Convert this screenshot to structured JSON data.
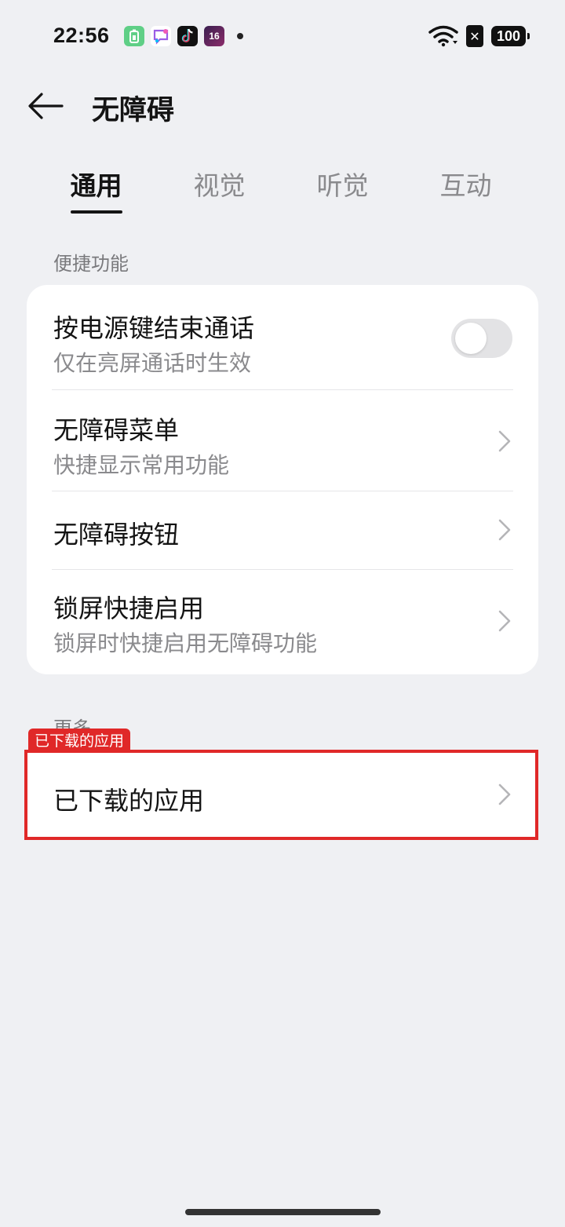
{
  "status_bar": {
    "time": "22:56",
    "battery_level": "100",
    "sim_icon_glyph": "✕",
    "notification_icons": [
      "battery-app-icon",
      "chat-app-icon",
      "tiktok-icon",
      "sixteen-app-icon"
    ],
    "sixteen_label": "16"
  },
  "header": {
    "title": "无障碍"
  },
  "tabs": [
    {
      "label": "通用",
      "active": true
    },
    {
      "label": "视觉",
      "active": false
    },
    {
      "label": "听觉",
      "active": false
    },
    {
      "label": "互动",
      "active": false
    }
  ],
  "sections": {
    "shortcut": {
      "header": "便捷功能",
      "items": [
        {
          "title": "按电源键结束通话",
          "subtitle": "仅在亮屏通话时生效",
          "control": "toggle",
          "toggle_on": false
        },
        {
          "title": "无障碍菜单",
          "subtitle": "快捷显示常用功能",
          "control": "chevron"
        },
        {
          "title": "无障碍按钮",
          "subtitle": "",
          "control": "chevron"
        },
        {
          "title": "锁屏快捷启用",
          "subtitle": "锁屏时快捷启用无障碍功能",
          "control": "chevron"
        }
      ]
    },
    "more": {
      "header": "更多",
      "items": [
        {
          "title": "已下载的应用",
          "control": "chevron"
        }
      ]
    }
  },
  "annotation": {
    "label": "已下载的应用",
    "color": "#e02828"
  },
  "colors": {
    "background": "#eff0f3",
    "card": "#ffffff",
    "primary_text": "#141414",
    "secondary_text": "#8a8a8d",
    "toggle_off": "#e3e3e5"
  }
}
